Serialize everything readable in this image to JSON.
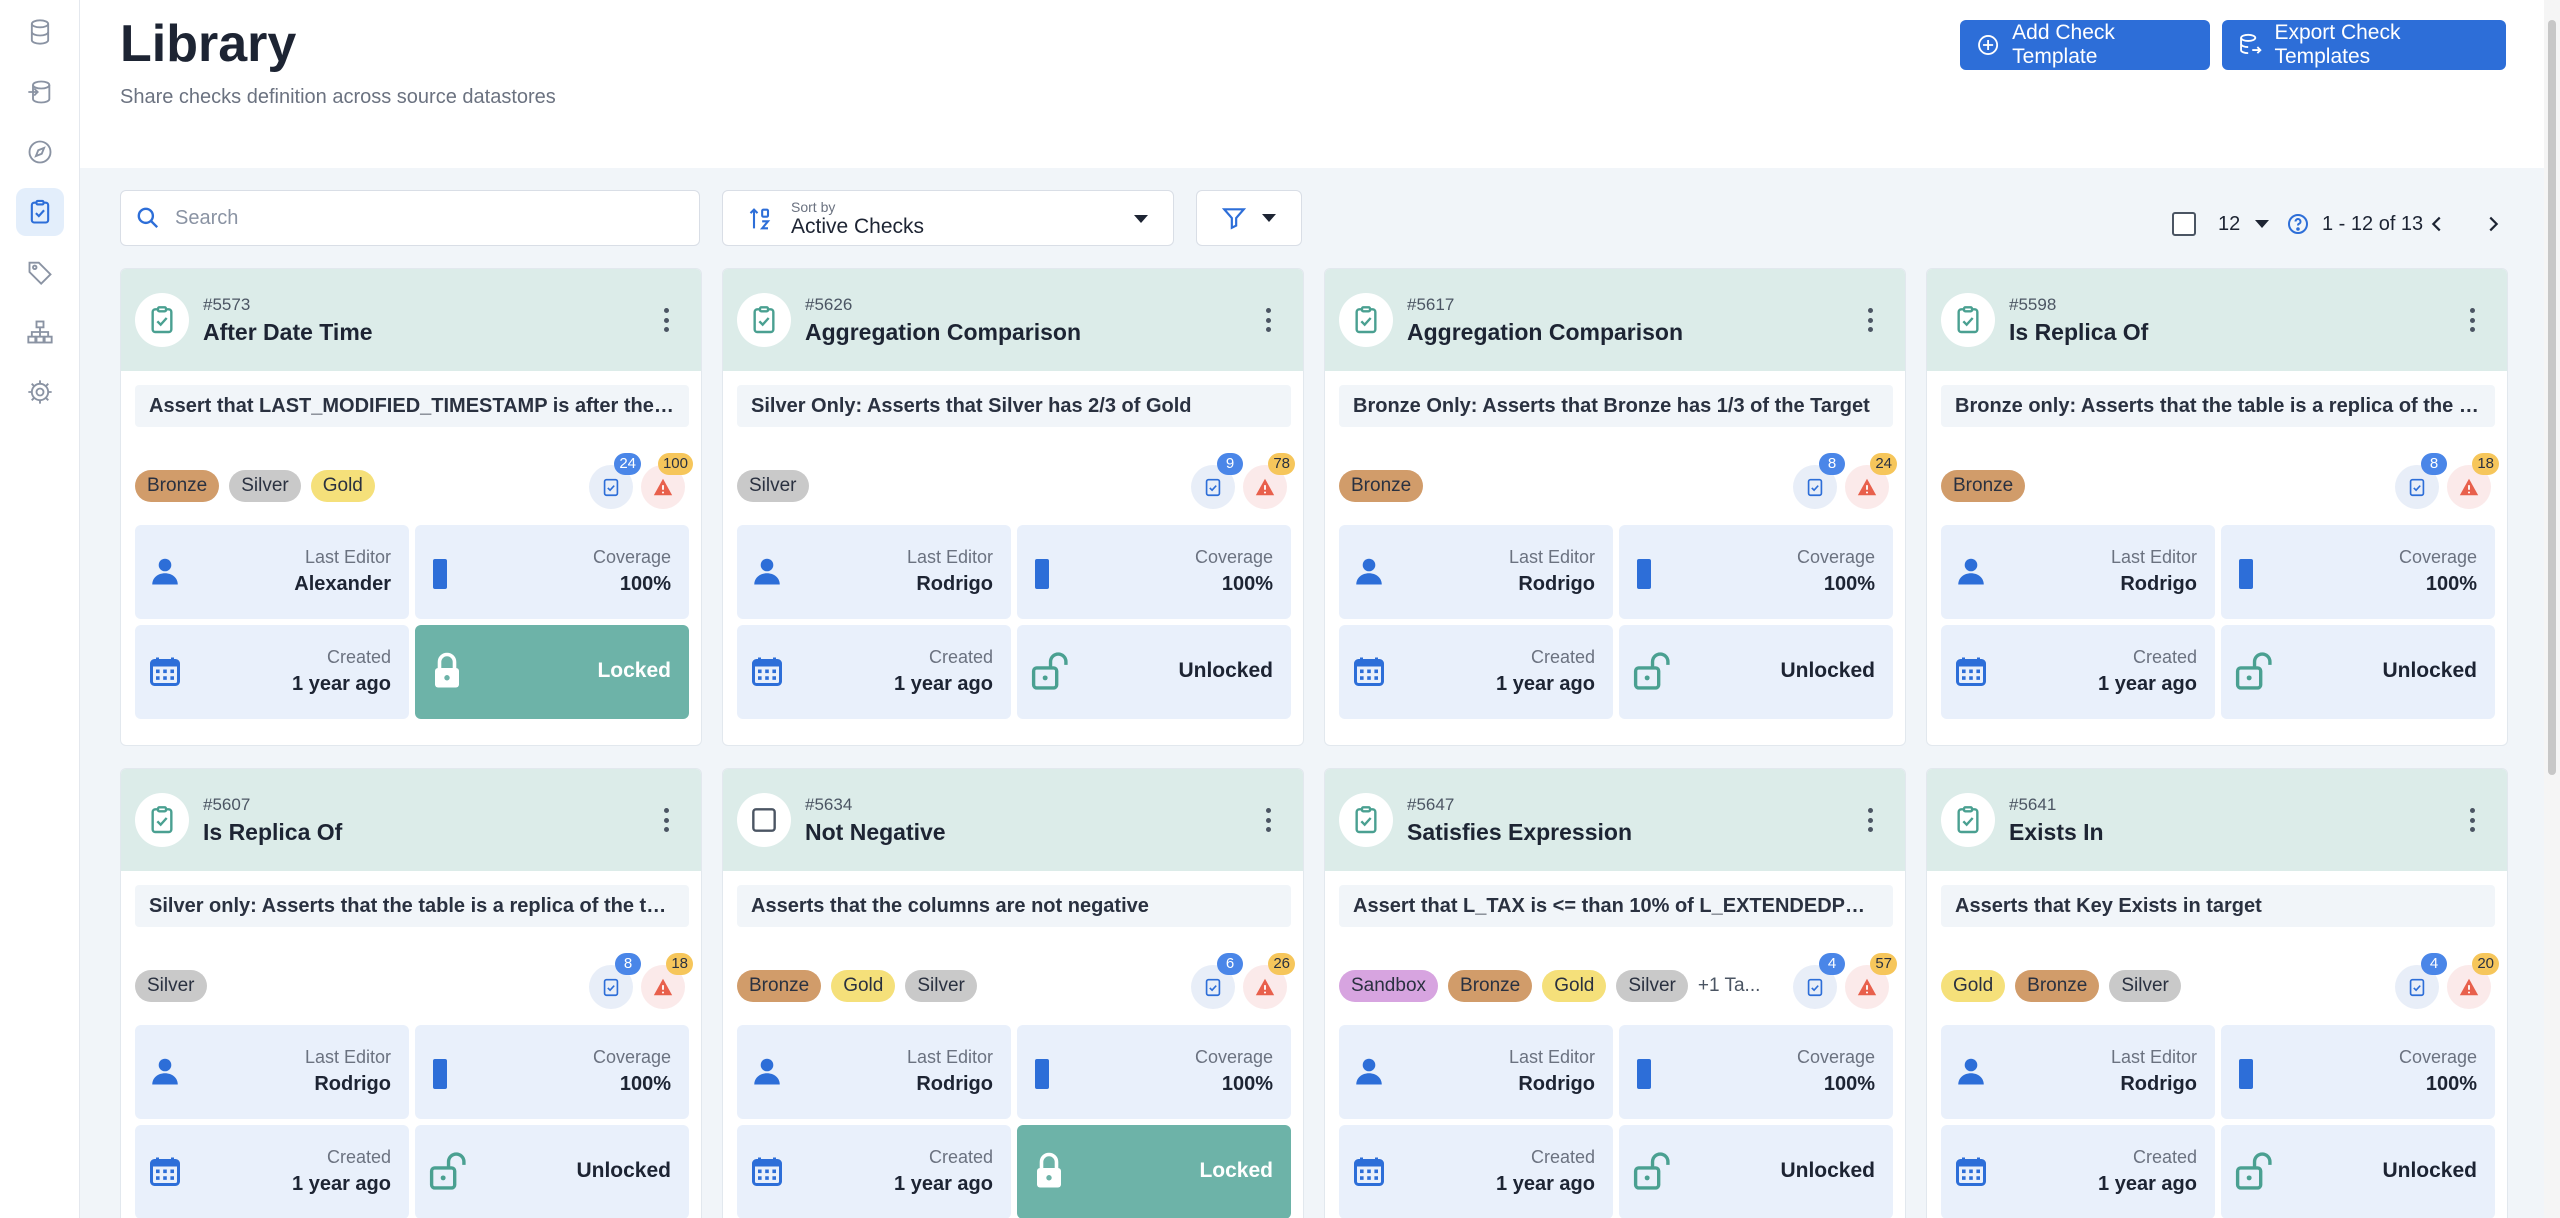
{
  "header": {
    "title": "Library",
    "subtitle": "Share checks definition across source datastores",
    "add_button": "Add Check Template",
    "export_button": "Export Check Templates"
  },
  "toolbar": {
    "search_placeholder": "Search",
    "sort_label": "Sort by",
    "sort_value": "Active Checks",
    "page_size": "12",
    "page_range": "1 - 12 of 13"
  },
  "labels": {
    "last_editor": "Last Editor",
    "coverage": "Coverage",
    "created": "Created"
  },
  "colors": {
    "primary": "#2d6ed8",
    "card_header": "#dcece9",
    "locked": "#6db3a8",
    "stat_bg": "#e9f0fb"
  },
  "cards": [
    {
      "id": "#5573",
      "name": "After Date Time",
      "description": "Assert that LAST_MODIFIED_TIMESTAMP is after the de...",
      "tags": [
        "Bronze",
        "Silver",
        "Gold"
      ],
      "more_tags": "",
      "checks": "24",
      "anomalies": "100",
      "editor": "Alexander",
      "coverage": "100%",
      "created": "1 year ago",
      "lock": "Locked",
      "icon": "clipboard-check-icon"
    },
    {
      "id": "#5626",
      "name": "Aggregation Comparison",
      "description": "Silver Only: Asserts that Silver has 2/3 of Gold",
      "tags": [
        "Silver"
      ],
      "more_tags": "",
      "checks": "9",
      "anomalies": "78",
      "editor": "Rodrigo",
      "coverage": "100%",
      "created": "1 year ago",
      "lock": "Unlocked",
      "icon": "clipboard-check-icon"
    },
    {
      "id": "#5617",
      "name": "Aggregation Comparison",
      "description": "Bronze Only: Asserts that Bronze has 1/3 of the Target",
      "tags": [
        "Bronze"
      ],
      "more_tags": "",
      "checks": "8",
      "anomalies": "24",
      "editor": "Rodrigo",
      "coverage": "100%",
      "created": "1 year ago",
      "lock": "Unlocked",
      "icon": "clipboard-check-icon"
    },
    {
      "id": "#5598",
      "name": "Is Replica Of",
      "description": "Bronze only: Asserts that the table is a replica of the tar...",
      "tags": [
        "Bronze"
      ],
      "more_tags": "",
      "checks": "8",
      "anomalies": "18",
      "editor": "Rodrigo",
      "coverage": "100%",
      "created": "1 year ago",
      "lock": "Unlocked",
      "icon": "clipboard-check-icon"
    },
    {
      "id": "#5607",
      "name": "Is Replica Of",
      "description": "Silver only: Asserts that the table is a replica of the tar...",
      "tags": [
        "Silver"
      ],
      "more_tags": "",
      "checks": "8",
      "anomalies": "18",
      "editor": "Rodrigo",
      "coverage": "100%",
      "created": "1 year ago",
      "lock": "Unlocked",
      "icon": "clipboard-check-icon"
    },
    {
      "id": "#5634",
      "name": "Not Negative",
      "description": "Asserts that the columns are not negative",
      "tags": [
        "Bronze",
        "Gold",
        "Silver"
      ],
      "more_tags": "",
      "checks": "6",
      "anomalies": "26",
      "editor": "Rodrigo",
      "coverage": "100%",
      "created": "1 year ago",
      "lock": "Locked",
      "icon": "checkbox-icon"
    },
    {
      "id": "#5647",
      "name": "Satisfies Expression",
      "description": "Assert that L_TAX is <= than 10% of L_EXTENDEDPRICE",
      "tags": [
        "Sandbox",
        "Bronze",
        "Gold",
        "Silver"
      ],
      "more_tags": "+1 Ta...",
      "checks": "4",
      "anomalies": "57",
      "editor": "Rodrigo",
      "coverage": "100%",
      "created": "1 year ago",
      "lock": "Unlocked",
      "icon": "clipboard-check-icon"
    },
    {
      "id": "#5641",
      "name": "Exists In",
      "description": "Asserts that Key Exists in target",
      "tags": [
        "Gold",
        "Bronze",
        "Silver"
      ],
      "more_tags": "",
      "checks": "4",
      "anomalies": "20",
      "editor": "Rodrigo",
      "coverage": "100%",
      "created": "1 year ago",
      "lock": "Unlocked",
      "icon": "clipboard-check-icon"
    }
  ]
}
